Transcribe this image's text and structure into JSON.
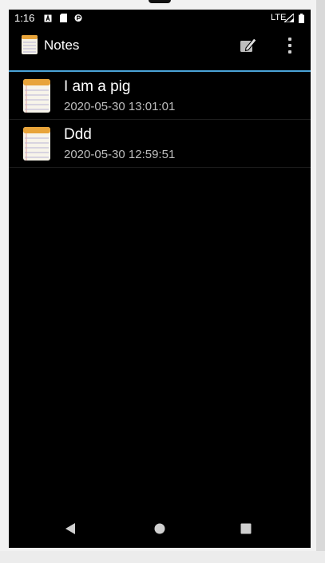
{
  "status_bar": {
    "time": "1:16",
    "network": "LTE"
  },
  "app_bar": {
    "title": "Notes",
    "accent_color": "#4aa3d8"
  },
  "notes": [
    {
      "title": "I am a pig",
      "date": "2020-05-30 13:01:01"
    },
    {
      "title": "Ddd",
      "date": "2020-05-30 12:59:51"
    }
  ],
  "icons": {
    "app": "notepad-icon",
    "compose": "compose-note-icon",
    "overflow": "more-vert-icon",
    "nav": [
      "back-icon",
      "home-icon",
      "recents-icon"
    ]
  }
}
